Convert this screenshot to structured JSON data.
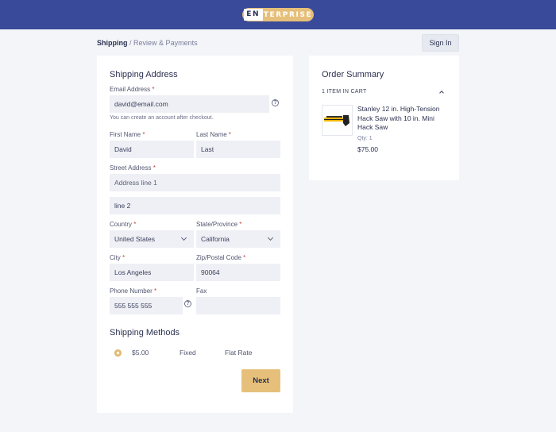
{
  "brand": {
    "logo_first": "EN",
    "logo_rest": "TERPRISE",
    "accent_color": "#e6c07a",
    "header_color": "#3a4a9a"
  },
  "breadcrumb": {
    "current": "Shipping",
    "separator": "/",
    "next": "Review & Payments"
  },
  "header": {
    "signin_label": "Sign In"
  },
  "shipping": {
    "title": "Shipping Address",
    "email": {
      "label": "Email Address",
      "value": "david@email.com",
      "note": "You can create an account after checkout.",
      "help_icon": "question-circle-icon"
    },
    "first_name": {
      "label": "First Name",
      "value": "David"
    },
    "last_name": {
      "label": "Last Name",
      "value": "Last"
    },
    "street": {
      "label": "Street Address",
      "line1": "Address line 1",
      "line2": "line 2"
    },
    "country": {
      "label": "Country",
      "value": "United States"
    },
    "state": {
      "label": "State/Province",
      "value": "California"
    },
    "city": {
      "label": "City",
      "value": "Los Angeles"
    },
    "zip": {
      "label": "Zip/Postal Code",
      "value": "90064"
    },
    "phone": {
      "label": "Phone Number",
      "value": "555 555 555",
      "help_icon": "question-circle-icon"
    },
    "fax": {
      "label": "Fax",
      "value": ""
    },
    "required_mark": "*"
  },
  "methods": {
    "title": "Shipping Methods",
    "items": [
      {
        "price": "$5.00",
        "type": "Fixed",
        "name": "Flat Rate",
        "selected": true
      }
    ]
  },
  "next_label": "Next",
  "summary": {
    "title": "Order Summary",
    "cart_count": "1 ITEM IN CART",
    "item": {
      "name": "Stanley 12 in. High-Tension Hack Saw with 10 in. Mini Hack Saw",
      "qty": "Qty: 1",
      "price": "$75.00",
      "image_icon": "hacksaw-image"
    }
  }
}
